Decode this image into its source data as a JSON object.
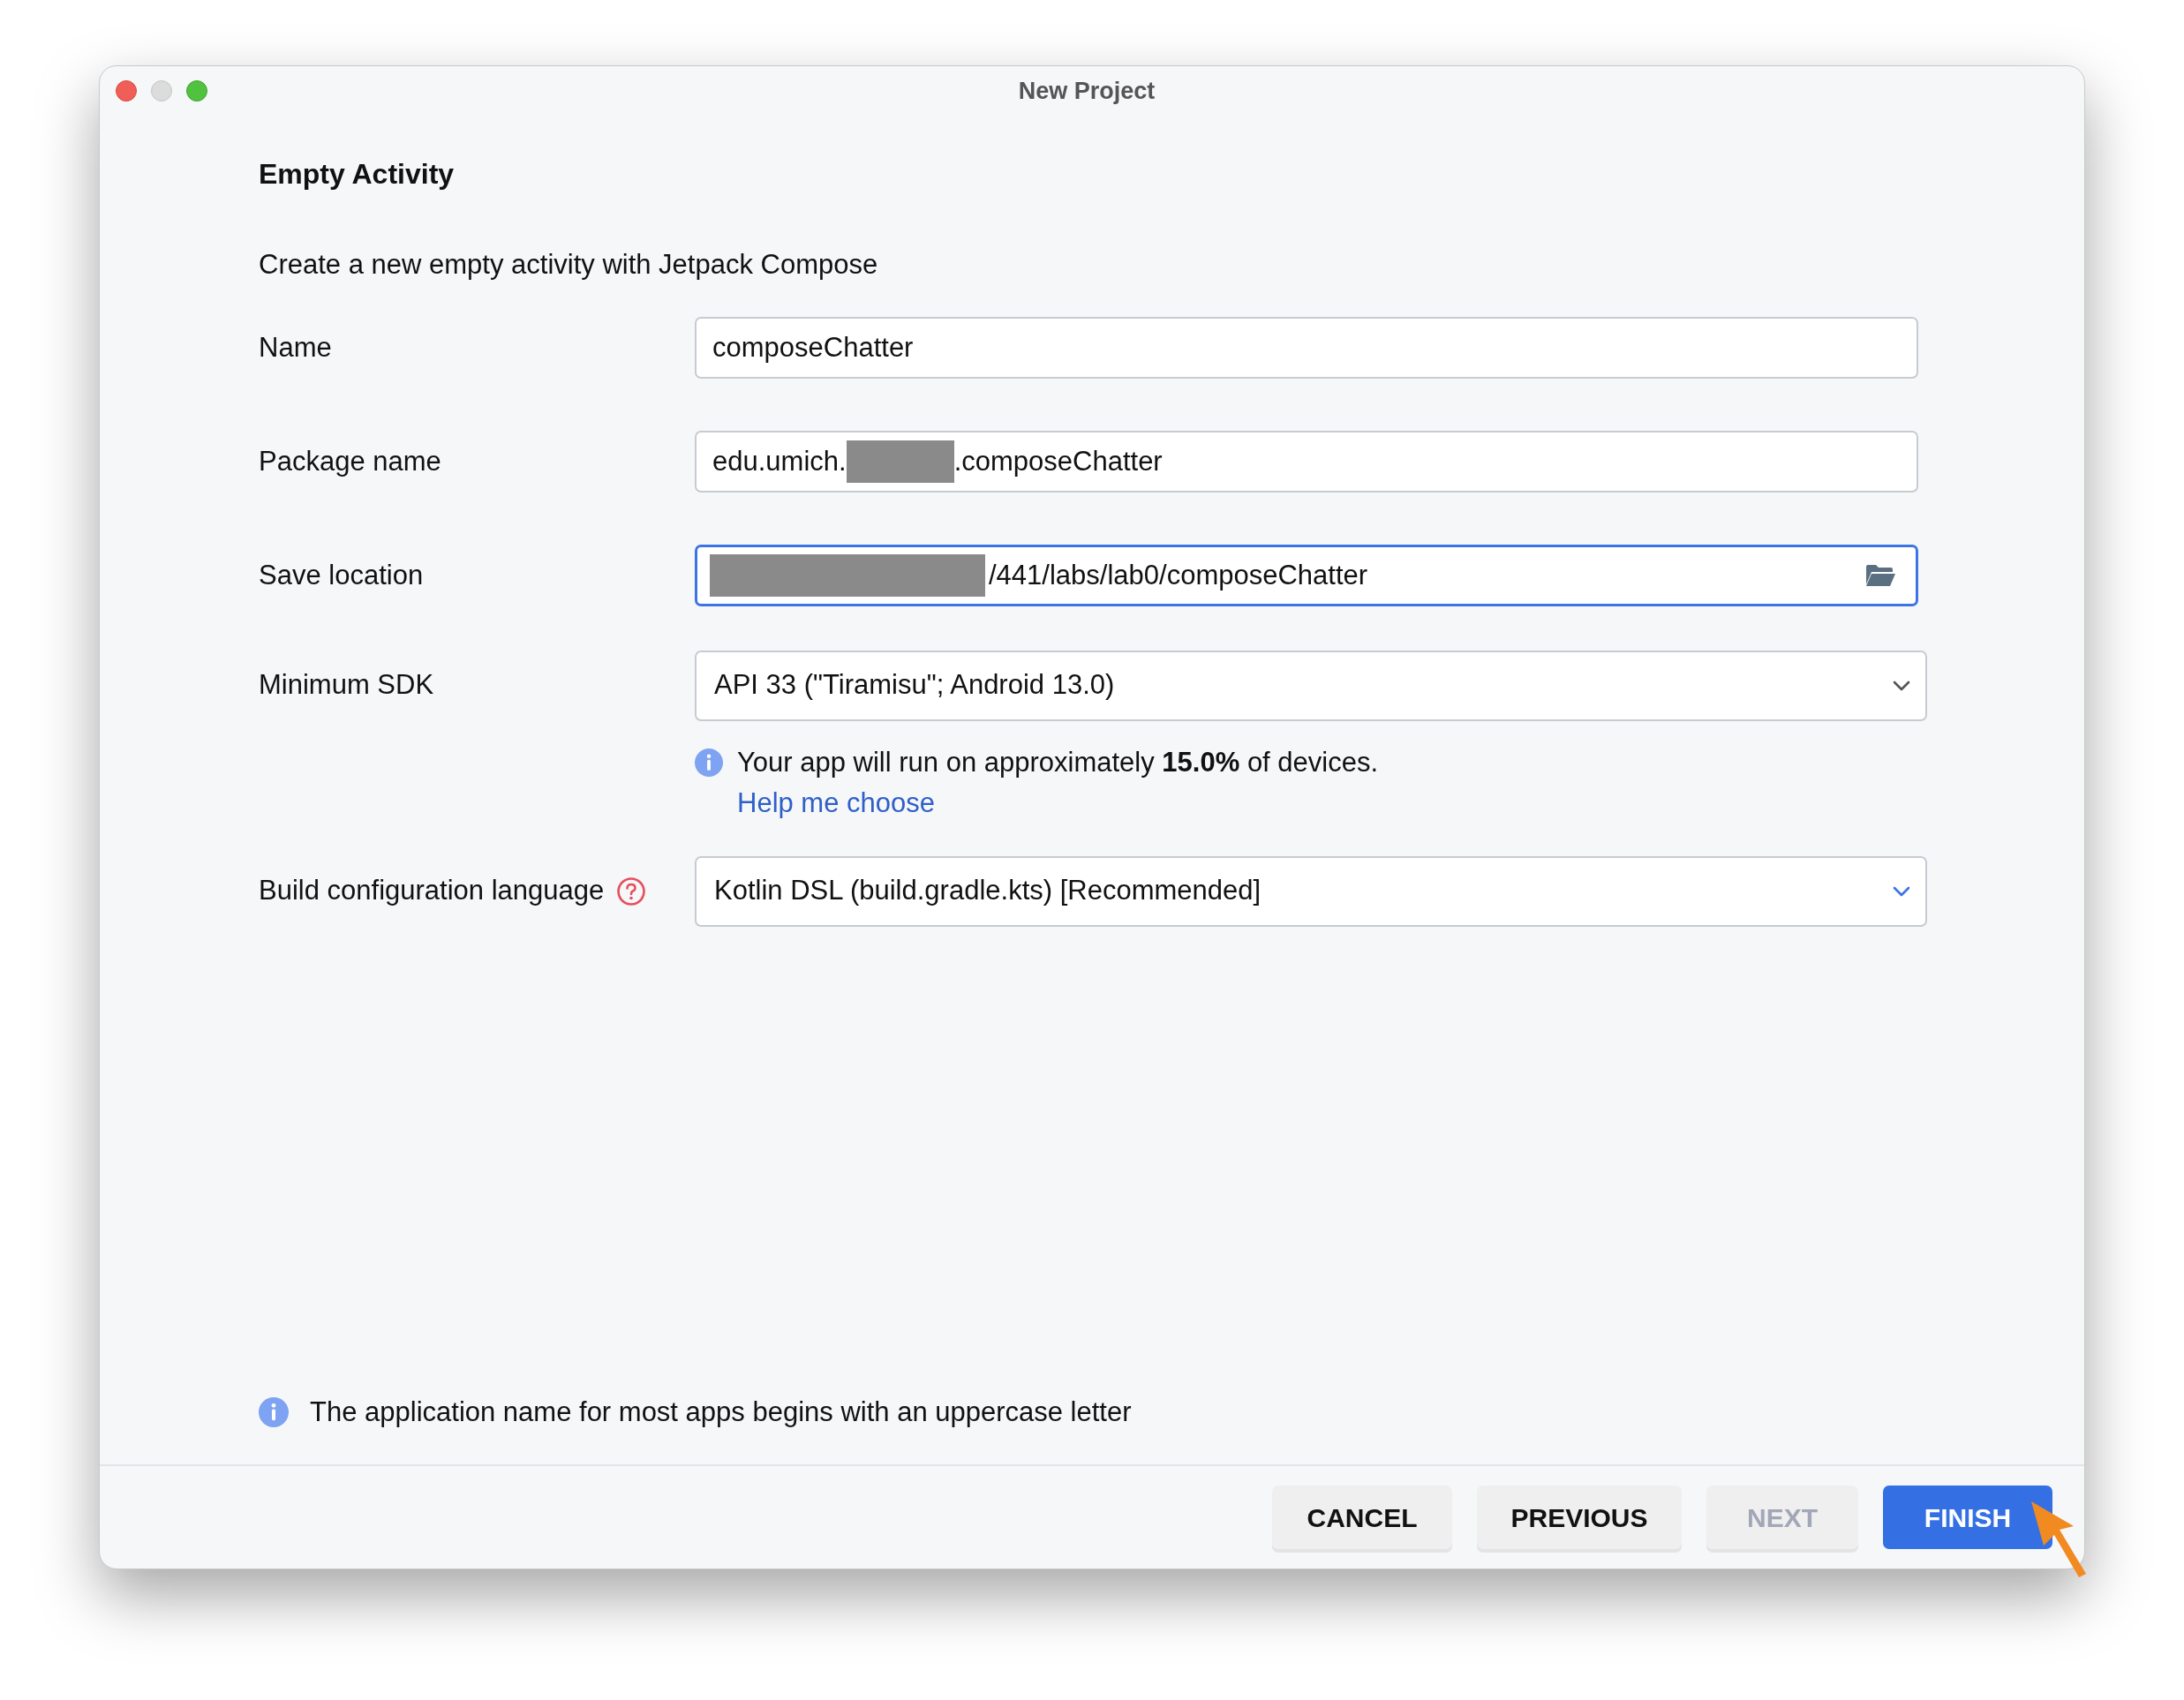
{
  "window": {
    "title": "New Project"
  },
  "heading": "Empty Activity",
  "description": "Create a new empty activity with Jetpack Compose",
  "fields": [
    {
      "kind": "text",
      "label": "Name",
      "value": "composeChatter",
      "focused": false
    },
    {
      "kind": "redacted_middle",
      "label": "Package name",
      "prefix": "edu.umich.",
      "suffix": ".composeChatter",
      "focused": false
    },
    {
      "kind": "redacted_path",
      "label": "Save location",
      "value": "/441/labs/lab0/composeChatter",
      "focused": true
    }
  ],
  "minimum_sdk": {
    "label": "Minimum SDK",
    "value": "API 33 (\"Tiramisu\"; Android 13.0)",
    "highlighted": false,
    "info": "Your app will run on approximately **15.0%** of devices.",
    "help_link": "Help me choose"
  },
  "build_language": {
    "label": "Build configuration language",
    "value": "Kotlin DSL (build.gradle.kts) [Recommended]",
    "highlighted": true
  },
  "hint": "The application name for most apps begins with an uppercase letter",
  "buttons": [
    {
      "label": "CANCEL",
      "disabled": false,
      "primary": false
    },
    {
      "label": "PREVIOUS",
      "disabled": false,
      "primary": false
    },
    {
      "label": "NEXT",
      "disabled": true,
      "primary": false
    },
    {
      "label": "FINISH",
      "disabled": false,
      "primary": true
    }
  ]
}
